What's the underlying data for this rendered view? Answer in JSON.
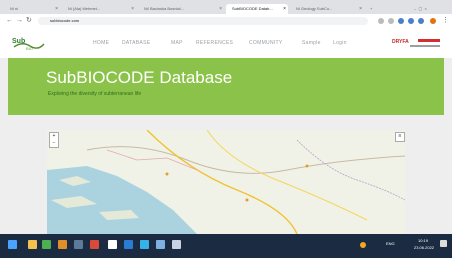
{
  "browser": {
    "tabs": [
      {
        "label": "Ni ni",
        "active": false
      },
      {
        "label": "Ni (Ala) Mehmet...",
        "active": false
      },
      {
        "label": "Ni/ Bacinska Bosnial...",
        "active": false
      },
      {
        "label": "SubBIOCODE Datab...",
        "active": true
      },
      {
        "label": "Ni Geology SubCo...",
        "active": false
      }
    ],
    "url": "subbiocode.com",
    "back_icon": "arrow-left-icon",
    "reload_icon": "reload-icon"
  },
  "site": {
    "nav": [
      "HOME",
      "DATABASE",
      "MAP",
      "REFERENCES",
      "COMMUNITY",
      "Sample",
      "Login"
    ],
    "partner_logo": "DRYFA ...",
    "hero_title": "SubBIOCODE Database",
    "hero_subtitle": "Exploring the diversity of subterranean life"
  },
  "map": {
    "zoom_in": "+",
    "zoom_out": "−",
    "layer_icon": "layers-icon"
  },
  "taskbar": {
    "time": "10:19",
    "date": "23.06.2022",
    "lang": "ENG"
  },
  "colors": {
    "hero": "#8bc34a",
    "taskbar": "#1a2b42"
  }
}
